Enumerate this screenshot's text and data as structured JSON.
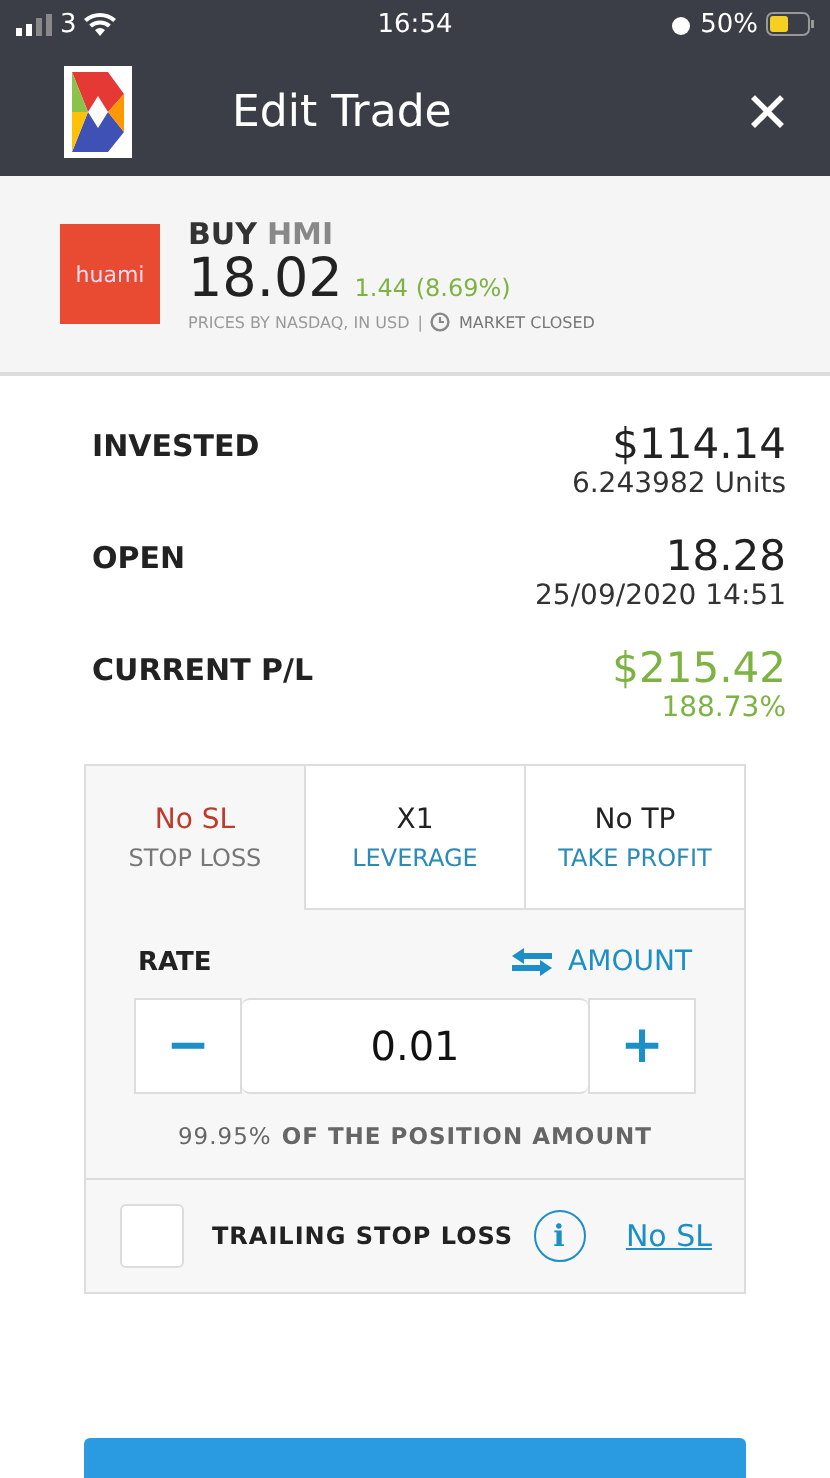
{
  "status_bar": {
    "carrier": "3",
    "time": "16:54",
    "battery": "50%"
  },
  "header": {
    "title": "Edit Trade",
    "close": "✕"
  },
  "instrument": {
    "logo_text": "huami",
    "action": "BUY",
    "symbol": "HMI",
    "price": "18.02",
    "change": "1.44 (8.69%)",
    "source": "PRICES BY NASDAQ, IN USD",
    "separator": "|",
    "market_status": "MARKET CLOSED"
  },
  "details": [
    {
      "label": "INVESTED",
      "value": "$114.14",
      "sub": "6.243982 Units",
      "positive": false
    },
    {
      "label": "OPEN",
      "value": "18.28",
      "sub": "25/09/2020 14:51",
      "positive": false
    },
    {
      "label": "CURRENT P/L",
      "value": "$215.42",
      "sub": "188.73%",
      "positive": true
    }
  ],
  "tabs": [
    {
      "value": "No SL",
      "label": "STOP LOSS",
      "selected": true
    },
    {
      "value": "X1",
      "label": "LEVERAGE",
      "selected": false
    },
    {
      "value": "No TP",
      "label": "TAKE PROFIT",
      "selected": false
    }
  ],
  "rate": {
    "label": "RATE",
    "toggle": "AMOUNT",
    "minus": "−",
    "value": "0.01",
    "plus": "+",
    "percent": "99.95%",
    "note": "OF THE POSITION AMOUNT"
  },
  "trailing": {
    "checked": false,
    "label": "TRAILING STOP LOSS",
    "info": "i",
    "link": "No SL"
  }
}
